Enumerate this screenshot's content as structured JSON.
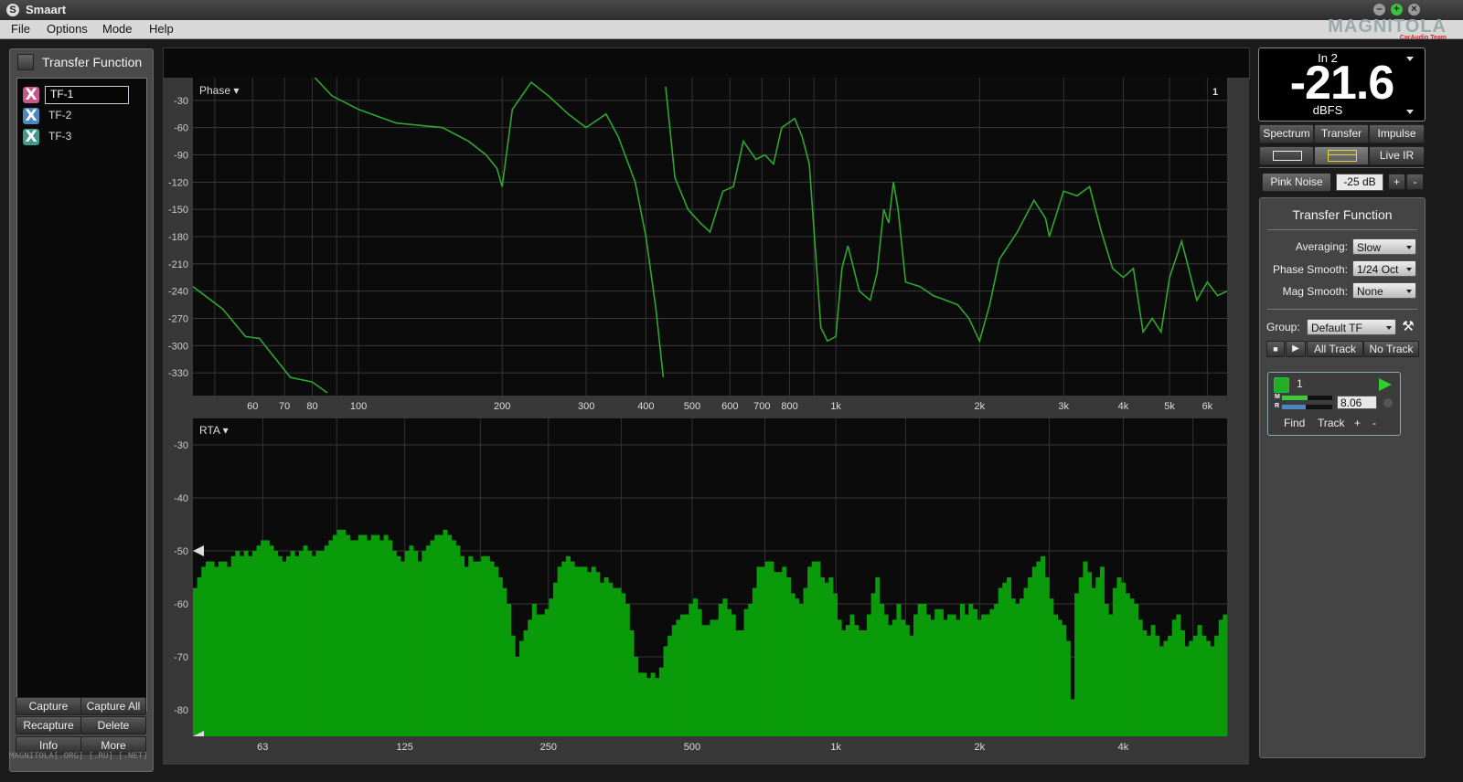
{
  "window": {
    "title": "Smaart"
  },
  "logo": {
    "main": "MAGNITOLA",
    "sub": "CarAudio Team"
  },
  "menu": [
    "File",
    "Options",
    "Mode",
    "Help"
  ],
  "left_panel": {
    "title": "Transfer Function",
    "items": [
      {
        "label": "TF-1",
        "color": "#c5578b"
      },
      {
        "label": "TF-2",
        "color": "#4d86c2"
      },
      {
        "label": "TF-3",
        "color": "#3f9a8d"
      }
    ],
    "buttons": [
      "Capture",
      "Capture All",
      "Recapture",
      "Delete",
      "Info",
      "More"
    ]
  },
  "watermark": "MAGNITOLA[.ORG] [.RU] [.NET]",
  "phase_plot": {
    "label": "Phase ▾",
    "index": "1",
    "y_ticks": [
      "-30",
      "-60",
      "-90",
      "-120",
      "-150",
      "-180",
      "-210",
      "-240",
      "-270",
      "-300",
      "-330"
    ],
    "x_ticks": [
      "60",
      "70",
      "80",
      "100",
      "200",
      "300",
      "400",
      "500",
      "600",
      "700",
      "800",
      "1k",
      "2k",
      "3k",
      "4k",
      "5k",
      "6k"
    ]
  },
  "rta_plot": {
    "label": "RTA ▾",
    "y_ticks": [
      "-30",
      "-40",
      "-50",
      "-60",
      "-70",
      "-80"
    ],
    "x_ticks": [
      "63",
      "125",
      "250",
      "500",
      "1k",
      "2k",
      "4k"
    ]
  },
  "chart_data": [
    {
      "type": "line",
      "title": "Phase",
      "xscale": "log",
      "x_range_hz": [
        45,
        6600
      ],
      "ylim": [
        -355,
        -5
      ],
      "ylabel": "",
      "xlabel": "",
      "line_color": "#2fa62f",
      "series": [
        {
          "x": [
            45,
            52,
            58,
            62,
            66,
            72,
            80,
            86
          ],
          "y": [
            -235,
            -260,
            -290,
            -292,
            -310,
            -335,
            -340,
            -352
          ]
        },
        {
          "x": [
            81,
            88,
            100,
            120,
            150,
            170,
            185,
            195,
            200,
            210,
            230,
            250,
            275,
            300,
            330,
            350,
            380,
            400,
            420,
            435
          ],
          "y": [
            -5,
            -25,
            -40,
            -55,
            -60,
            -75,
            -90,
            -105,
            -125,
            -40,
            -10,
            -25,
            -45,
            -60,
            -45,
            -70,
            -120,
            -180,
            -260,
            -335
          ]
        },
        {
          "x": [
            440,
            460,
            490,
            520,
            545,
            580,
            610,
            640,
            680,
            710,
            740,
            770,
            820,
            850,
            880,
            930,
            960,
            1000,
            1030,
            1060
          ],
          "y": [
            -15,
            -115,
            -150,
            -165,
            -175,
            -130,
            -125,
            -75,
            -95,
            -90,
            -100,
            -60,
            -50,
            -70,
            -100,
            -280,
            -295,
            -290,
            -215,
            -190
          ]
        },
        {
          "x": [
            1060,
            1120,
            1180,
            1220,
            1260,
            1290,
            1320,
            1350,
            1400,
            1500,
            1600,
            1700,
            1800,
            1900,
            2000,
            2100,
            2200,
            2400,
            2600,
            2750,
            2800
          ],
          "y": [
            -190,
            -240,
            -250,
            -220,
            -150,
            -165,
            -120,
            -150,
            -230,
            -235,
            -245,
            -250,
            -255,
            -270,
            -295,
            -255,
            -205,
            -175,
            -140,
            -160,
            -180
          ]
        },
        {
          "x": [
            2800,
            3000,
            3200,
            3400,
            3600,
            3800,
            4000,
            4200,
            4400,
            4600,
            4800,
            5000,
            5300,
            5700,
            6000,
            6300,
            6600
          ],
          "y": [
            -180,
            -130,
            -135,
            -125,
            -175,
            -215,
            -225,
            -215,
            -285,
            -270,
            -285,
            -225,
            -185,
            -250,
            -230,
            -245,
            -240
          ]
        }
      ]
    },
    {
      "type": "bar",
      "title": "RTA",
      "xscale": "log",
      "ylim": [
        -85,
        -25
      ],
      "bar_color": "#0a9b0a",
      "note": "1/24-octave RTA bars; values in dB approximated from the graph",
      "x_range_hz": [
        45,
        6600
      ],
      "values": [
        -57,
        -55,
        -53,
        -52,
        -52,
        -53,
        -52,
        -52,
        -53,
        -51,
        -50,
        -51,
        -50,
        -51,
        -50,
        -49,
        -48,
        -48,
        -49,
        -50,
        -51,
        -52,
        -51,
        -50,
        -51,
        -50,
        -49,
        -50,
        -51,
        -50,
        -50,
        -49,
        -48,
        -47,
        -46,
        -46,
        -47,
        -48,
        -48,
        -47,
        -47,
        -48,
        -47,
        -47,
        -48,
        -47,
        -48,
        -50,
        -51,
        -52,
        -50,
        -49,
        -50,
        -52,
        -50,
        -49,
        -48,
        -47,
        -47,
        -46,
        -47,
        -48,
        -49,
        -51,
        -53,
        -51,
        -52,
        -52,
        -51,
        -51,
        -52,
        -53,
        -55,
        -57,
        -60,
        -66,
        -70,
        -67,
        -65,
        -63,
        -60,
        -62,
        -62,
        -61,
        -59,
        -56,
        -53,
        -52,
        -51,
        -52,
        -53,
        -53,
        -53,
        -54,
        -53,
        -54,
        -56,
        -55,
        -56,
        -57,
        -57,
        -58,
        -60,
        -65,
        -70,
        -73,
        -73,
        -74,
        -73,
        -74,
        -72,
        -68,
        -66,
        -64,
        -63,
        -62,
        -62,
        -60,
        -59,
        -61,
        -64,
        -64,
        -63,
        -63,
        -60,
        -59,
        -61,
        -62,
        -65,
        -65,
        -61,
        -60,
        -57,
        -53,
        -53,
        -52,
        -52,
        -54,
        -54,
        -53,
        -55,
        -58,
        -59,
        -60,
        -57,
        -53,
        -52,
        -52,
        -55,
        -56,
        -55,
        -58,
        -63,
        -65,
        -64,
        -62,
        -64,
        -65,
        -65,
        -62,
        -58,
        -55,
        -60,
        -62,
        -64,
        -63,
        -60,
        -63,
        -64,
        -66,
        -62,
        -60,
        -60,
        -62,
        -63,
        -61,
        -61,
        -63,
        -62,
        -62,
        -63,
        -60,
        -62,
        -60,
        -61,
        -63,
        -62,
        -62,
        -61,
        -60,
        -57,
        -56,
        -55,
        -59,
        -60,
        -59,
        -57,
        -55,
        -53,
        -52,
        -51,
        -55,
        -59,
        -62,
        -63,
        -64,
        -67,
        -78,
        -58,
        -55,
        -52,
        -54,
        -57,
        -55,
        -53,
        -60,
        -62,
        -57,
        -55,
        -56,
        -58,
        -59,
        -60,
        -63,
        -65,
        -66,
        -64,
        -66,
        -68,
        -67,
        -66,
        -63,
        -62,
        -65,
        -68,
        -67,
        -66,
        -64,
        -66,
        -67,
        -68,
        -66,
        -63,
        -62
      ]
    }
  ],
  "right_panel": {
    "meter": {
      "channel": "In 2",
      "value": "-21.6",
      "unit": "dBFS"
    },
    "mode_buttons": [
      "Spectrum",
      "Transfer",
      "Impulse"
    ],
    "live_ir": "Live IR",
    "generator": {
      "label": "Pink Noise",
      "level": "-25 dB",
      "plus": "+",
      "minus": "-"
    },
    "tf_settings": {
      "title": "Transfer Function",
      "averaging_label": "Averaging:",
      "averaging_value": "Slow",
      "phase_smooth_label": "Phase Smooth:",
      "phase_smooth_value": "1/24 Oct",
      "mag_smooth_label": "Mag Smooth:",
      "mag_smooth_value": "None",
      "group_label": "Group:",
      "group_value": "Default TF",
      "all_track": "All Track",
      "no_track": "No Track"
    },
    "measurement": {
      "name": "1",
      "m_label": "M",
      "r_label": "R",
      "delay_value": "8.06",
      "find": "Find",
      "track": "Track",
      "plus": "+",
      "minus": "-"
    }
  }
}
